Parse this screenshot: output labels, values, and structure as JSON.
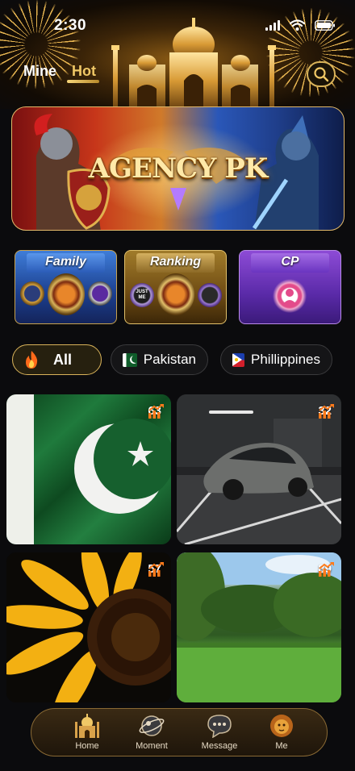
{
  "status_bar": {
    "time": "2:30"
  },
  "header": {
    "tabs": [
      {
        "label": "Mine"
      },
      {
        "label": "Hot"
      }
    ],
    "active_tab": "Hot"
  },
  "banner": {
    "title": "AGENCY PK"
  },
  "categories": [
    {
      "label": "Family"
    },
    {
      "label": "Ranking"
    },
    {
      "label": "CP"
    }
  ],
  "ranking_badge_text": "JUST ME",
  "filters": [
    {
      "label": "All",
      "icon": "fire-icon",
      "selected": true
    },
    {
      "label": "Pakistan",
      "icon": "pakistan-flag-icon",
      "selected": false
    },
    {
      "label": "Phillippines",
      "icon": "philippines-flag-icon",
      "selected": false
    }
  ],
  "rooms": [
    {
      "count": "63",
      "image": "pakistan-flag"
    },
    {
      "count": "32",
      "image": "sports-car"
    },
    {
      "count": "57",
      "image": "sunflower"
    },
    {
      "count": "89",
      "image": "park"
    }
  ],
  "nav": [
    {
      "label": "Home",
      "icon": "palace-icon"
    },
    {
      "label": "Moment",
      "icon": "planet-icon"
    },
    {
      "label": "Message",
      "icon": "chat-icon"
    },
    {
      "label": "Me",
      "icon": "lion-icon"
    }
  ],
  "colors": {
    "accent_gold": "#d9b35a",
    "hot_tab": "#f0c866",
    "count_icon": "#ff7a1a",
    "background": "#0b0b0d"
  }
}
